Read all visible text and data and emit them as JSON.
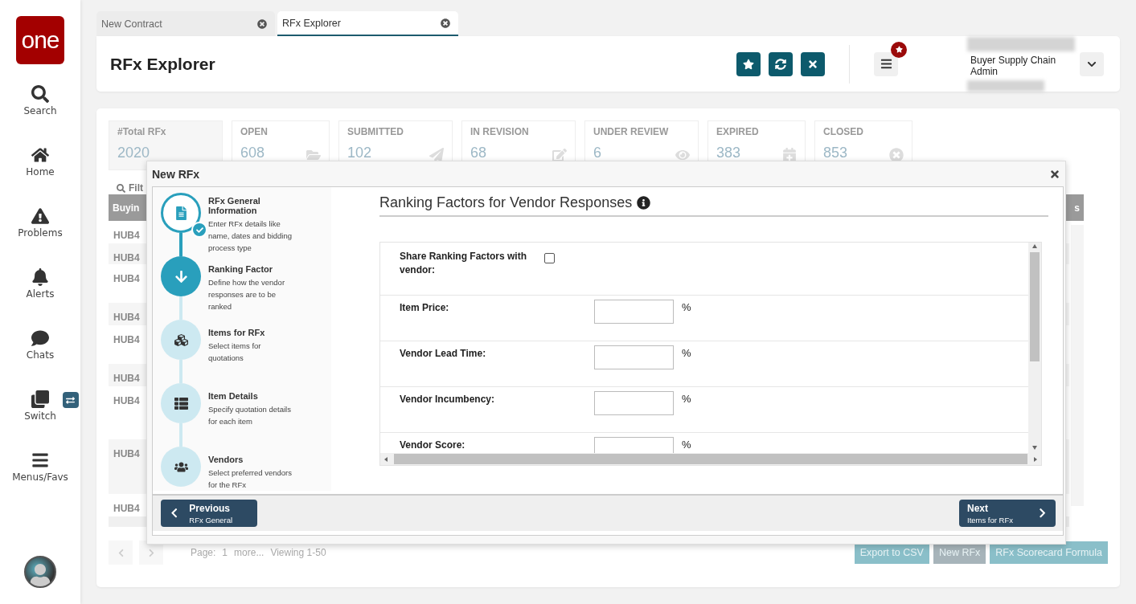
{
  "sidebar": {
    "logo": "one",
    "items": [
      {
        "label": "Search",
        "kind": "search"
      },
      {
        "label": "Home",
        "kind": "home"
      },
      {
        "label": "Problems",
        "kind": "problems"
      },
      {
        "label": "Alerts",
        "kind": "alerts"
      },
      {
        "label": "Chats",
        "kind": "chats"
      },
      {
        "label": "Switch",
        "kind": "switch"
      },
      {
        "label": "Menus/Favs",
        "kind": "menus"
      }
    ]
  },
  "tabs": [
    {
      "label": "New Contract",
      "selected": false
    },
    {
      "label": "RFx Explorer",
      "selected": true
    }
  ],
  "header": {
    "title": "RFx Explorer",
    "user_role": "Buyer Supply Chain Admin"
  },
  "stats": [
    {
      "label": "#Total RFx",
      "value": "2020",
      "kind": "total"
    },
    {
      "label": "OPEN",
      "value": "608",
      "kind": "open"
    },
    {
      "label": "SUBMITTED",
      "value": "102",
      "kind": "submitted"
    },
    {
      "label": "IN REVISION",
      "value": "68",
      "kind": "revision"
    },
    {
      "label": "UNDER REVIEW",
      "value": "6",
      "kind": "review"
    },
    {
      "label": "EXPIRED",
      "value": "383",
      "kind": "expired"
    },
    {
      "label": "CLOSED",
      "value": "853",
      "kind": "closed"
    }
  ],
  "filter_label": "Filt",
  "table": {
    "columns": [
      "Buyin",
      "s"
    ],
    "rows": [
      "HUB4",
      "HUB4",
      "HUB4",
      "HUB4",
      "HUB4",
      "HUB4",
      "HUB4",
      "HUB4",
      "HUB4"
    ]
  },
  "pagination": {
    "page_label": "Page:",
    "page": "1",
    "more": "more...",
    "viewing": "Viewing 1-50"
  },
  "actions": [
    "Export to CSV",
    "New RFx",
    "RFx Scorecard Formula"
  ],
  "dialog": {
    "title": "New RFx",
    "steps": [
      {
        "title": "RFx General Information",
        "description": "Enter RFx details like name, dates and bidding process type",
        "completed": true,
        "selected": false,
        "kind": "document"
      },
      {
        "title": "Ranking Factor",
        "description": "Define how the vendor responses are to be ranked",
        "completed": false,
        "selected": true,
        "kind": "arrow"
      },
      {
        "title": "Items for RFx",
        "description": "Select items for quotations",
        "completed": false,
        "selected": false,
        "kind": "cubes"
      },
      {
        "title": "Item Details",
        "description": "Specify quotation details for each item",
        "completed": false,
        "selected": false,
        "kind": "list"
      },
      {
        "title": "Vendors",
        "description": "Select preferred vendors for the RFx",
        "completed": false,
        "selected": false,
        "kind": "people"
      }
    ],
    "heading": "Ranking Factors for Vendor Responses",
    "share": {
      "label": "Share Ranking Factors with vendor:",
      "checked": false
    },
    "factors": [
      {
        "label": "Item Price:",
        "unit": "%"
      },
      {
        "label": "Vendor Lead Time:",
        "unit": "%"
      },
      {
        "label": "Vendor Incumbency:",
        "unit": "%"
      },
      {
        "label": "Vendor Score:",
        "unit": "%"
      }
    ],
    "previous": {
      "label": "Previous",
      "sub": "RFx General"
    },
    "next": {
      "label": "Next",
      "sub": "Items for RFx"
    }
  }
}
